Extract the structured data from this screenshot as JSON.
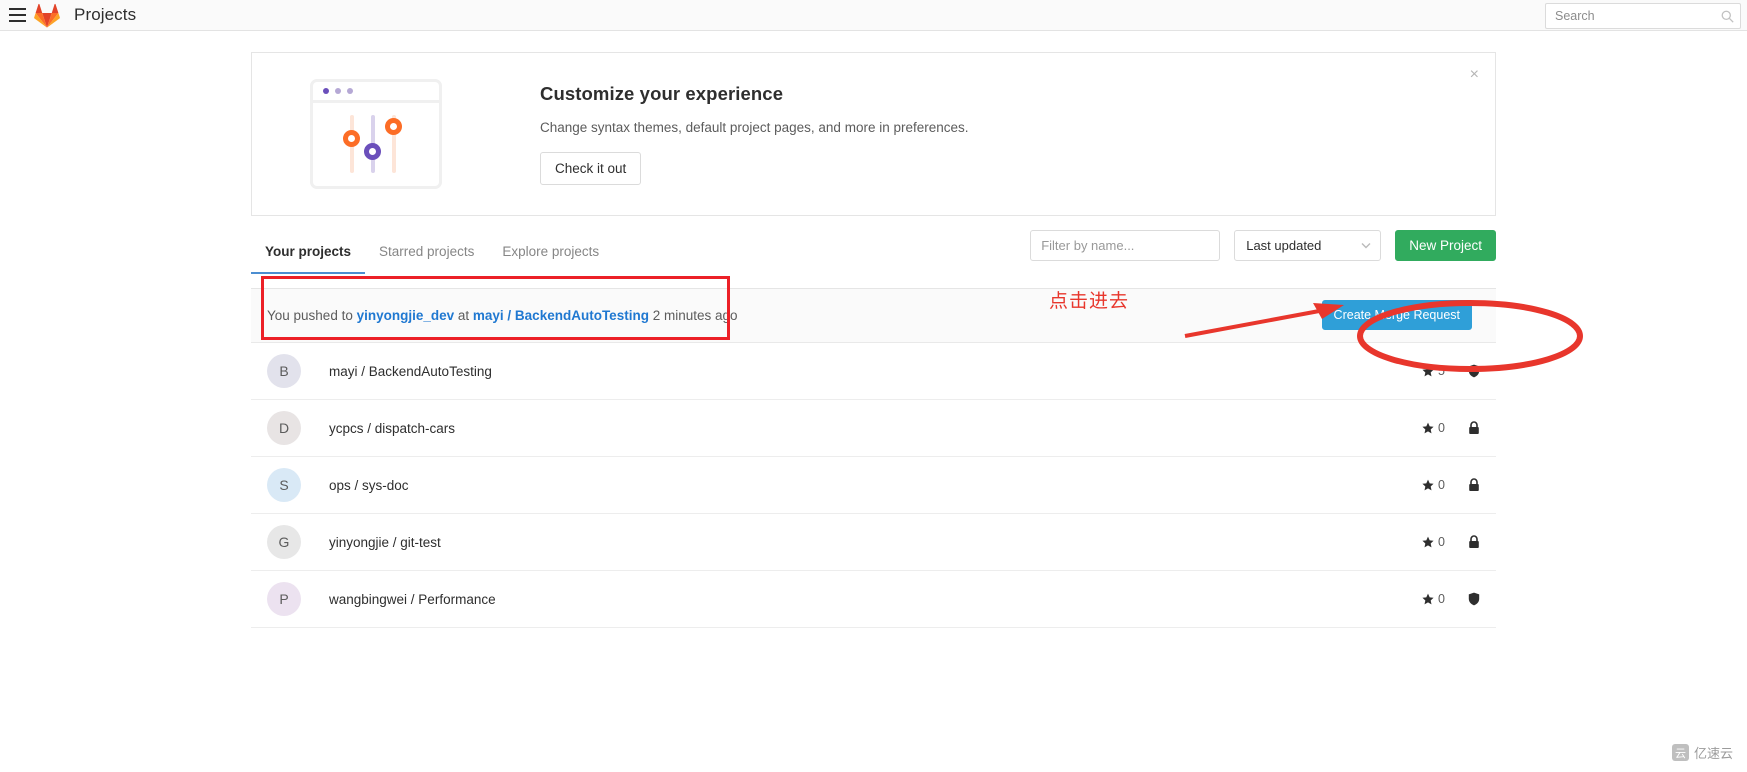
{
  "navbar": {
    "title": "Projects",
    "menu_icon": "hamburger-icon",
    "logo_icon": "gitlab-logo-icon",
    "search": {
      "placeholder": "Search",
      "value": "",
      "icon": "search-icon"
    }
  },
  "banner": {
    "title": "Customize your experience",
    "description": "Change syntax themes, default project pages, and more in preferences.",
    "button_label": "Check it out",
    "close_label": "×",
    "illustration_icon": "preferences-sliders-illustration",
    "colors": {
      "orange": "#fc6d26",
      "purple": "#6b4fbb"
    }
  },
  "tabs": [
    {
      "label": "Your projects",
      "active": true
    },
    {
      "label": "Starred projects",
      "active": false
    },
    {
      "label": "Explore projects",
      "active": false
    }
  ],
  "controls": {
    "filter": {
      "placeholder": "Filter by name...",
      "value": ""
    },
    "sort": {
      "selected": "Last updated",
      "chevron_icon": "chevron-down-icon"
    },
    "new_project_label": "New Project",
    "new_project_color": "#31ab5e"
  },
  "activity": {
    "prefix": "You pushed to ",
    "branch": "yinyongjie_dev",
    "middle": " at ",
    "project": "mayi / BackendAutoTesting",
    "suffix": " 2 minutes ago",
    "merge_request_label": "Create Merge Request",
    "merge_request_color": "#2f9fd8"
  },
  "projects": [
    {
      "initial": "B",
      "avatar_color": "#e2e2ec",
      "name": "mayi / BackendAutoTesting",
      "stars": "5",
      "visibility": "internal",
      "visibility_icon": "shield-icon"
    },
    {
      "initial": "D",
      "avatar_color": "#e8e4e4",
      "name": "ycpcs / dispatch-cars",
      "stars": "0",
      "visibility": "private",
      "visibility_icon": "lock-icon"
    },
    {
      "initial": "S",
      "avatar_color": "#d9e9f6",
      "name": "ops / sys-doc",
      "stars": "0",
      "visibility": "private",
      "visibility_icon": "lock-icon"
    },
    {
      "initial": "G",
      "avatar_color": "#e7e7e7",
      "name": "yinyongjie / git-test",
      "stars": "0",
      "visibility": "private",
      "visibility_icon": "lock-icon"
    },
    {
      "initial": "P",
      "avatar_color": "#ece2f0",
      "name": "wangbingwei / Performance",
      "stars": "0",
      "visibility": "internal",
      "visibility_icon": "shield-icon"
    }
  ],
  "annotations": {
    "callout_text": "点击进去",
    "color": "#e8362c",
    "box_target": "activity-row",
    "ellipse_target": "create-merge-request-button",
    "arrow": "red-arrow-pointing-right"
  },
  "watermark": {
    "text": "亿速云",
    "mark": "云"
  },
  "icons": {
    "star": "star-icon",
    "lock": "lock-icon",
    "shield": "shield-icon"
  }
}
